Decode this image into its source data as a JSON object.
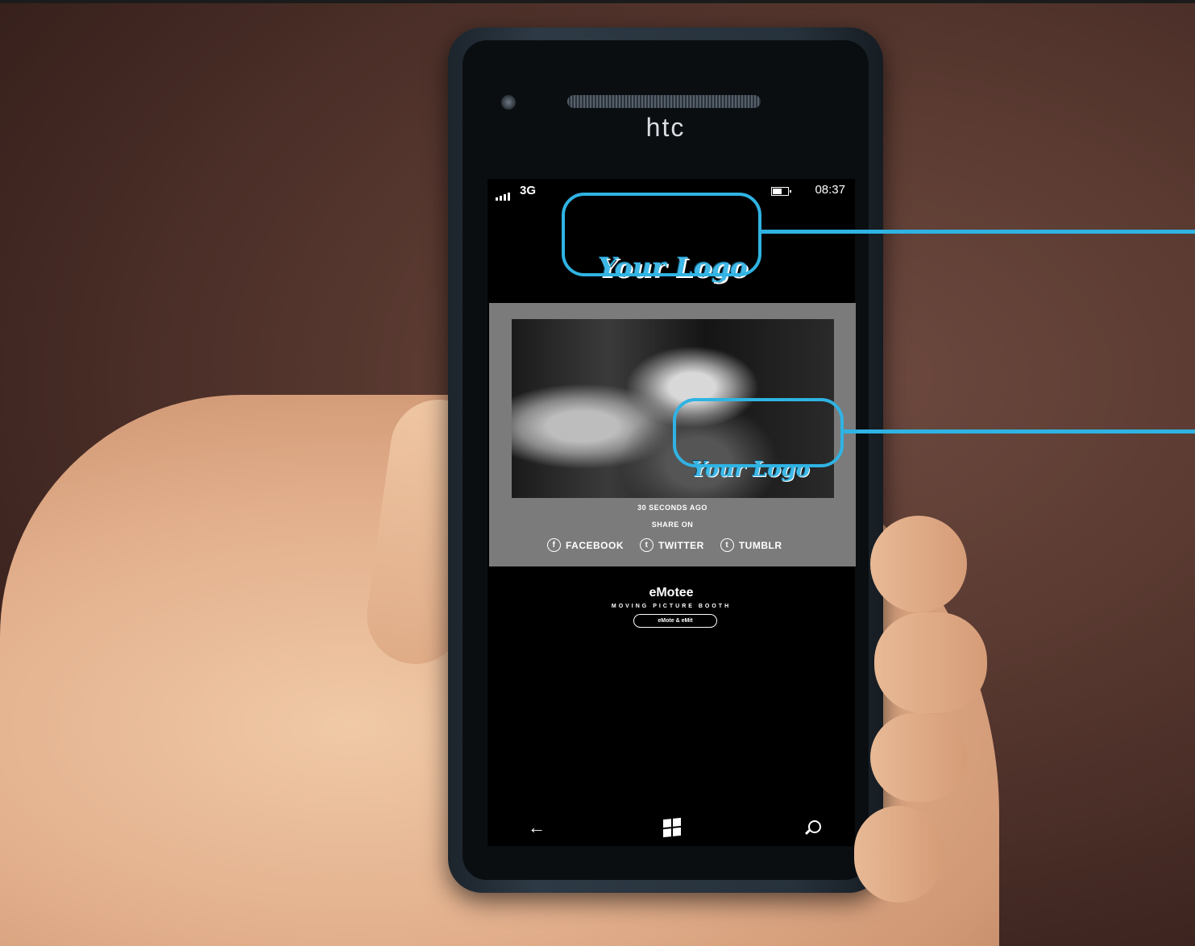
{
  "device": {
    "brand": "htc",
    "status": {
      "network": "3G",
      "time": "08:37"
    }
  },
  "app": {
    "top_logo": "Your Logo",
    "photo_logo": "Your Logo",
    "time_ago": "30 SECONDS AGO",
    "share_label": "SHARE ON",
    "share_options": [
      {
        "icon": "facebook-icon",
        "glyph": "f",
        "label": "FACEBOOK"
      },
      {
        "icon": "twitter-icon",
        "glyph": "t",
        "label": "TWITTER"
      },
      {
        "icon": "tumblr-icon",
        "glyph": "t",
        "label": "TUMBLR"
      }
    ],
    "footer": {
      "brand": "eMotee",
      "tagline": "MOVING PICTURE BOOTH",
      "pill": "eMote & eMit"
    }
  },
  "nav": {
    "back": "←",
    "search_icon": "search-icon",
    "windows_icon": "windows-icon"
  },
  "colors": {
    "accent": "#2fb3e3",
    "card": "#7b7b7b"
  }
}
